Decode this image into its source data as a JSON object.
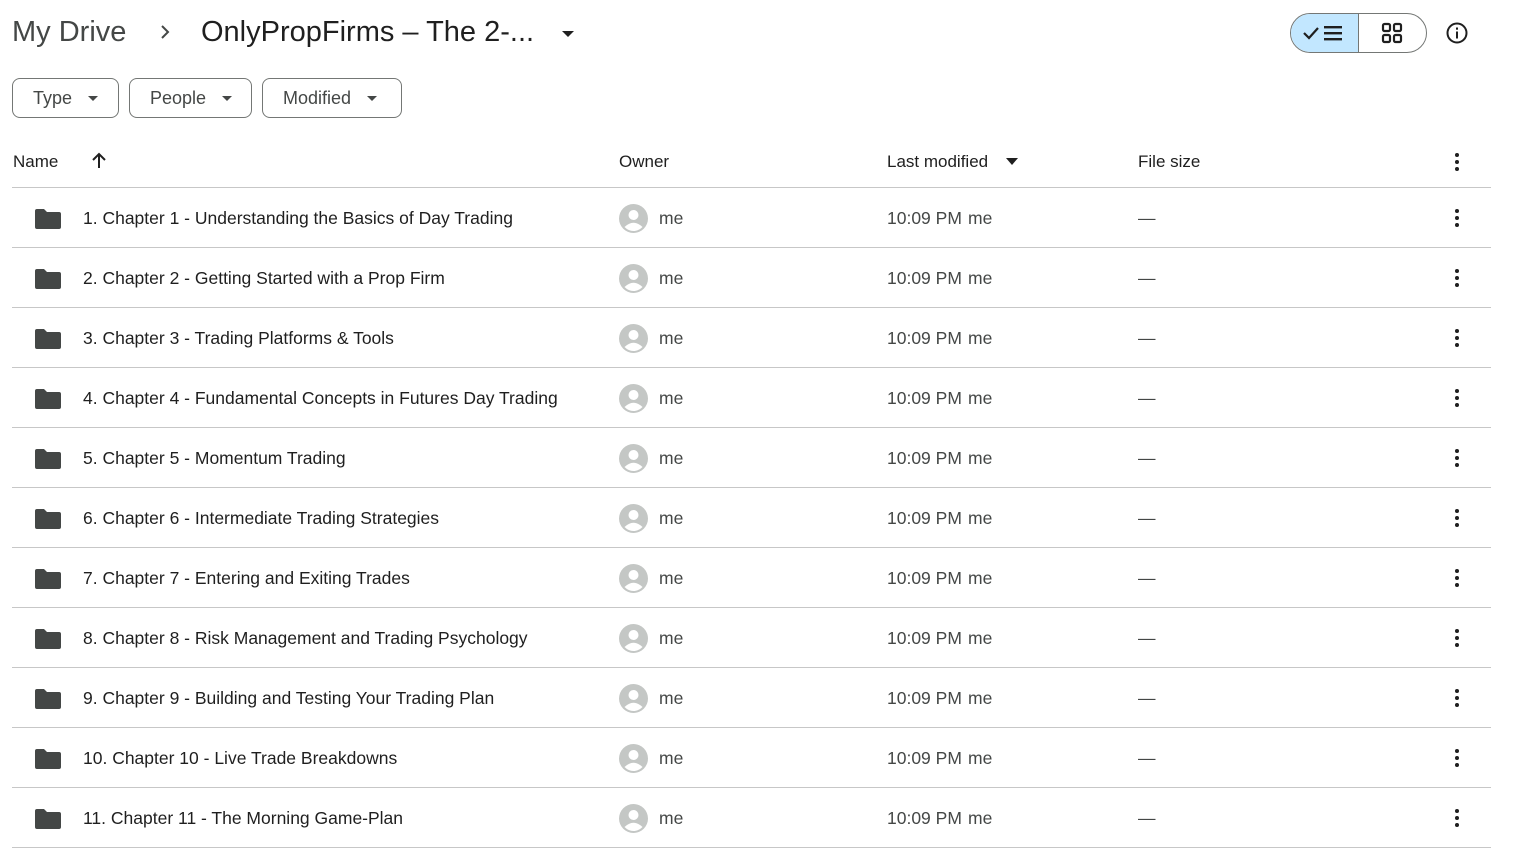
{
  "breadcrumb": {
    "root": "My Drive",
    "separator_icon": "chevron-right-icon",
    "current": "OnlyPropFirms – The 2-...",
    "caret_icon": "caret-down-icon"
  },
  "toolbar": {
    "list_view_icon": "check-list-icon",
    "grid_view_icon": "grid-icon",
    "info_icon": "info-icon",
    "active_view": "list",
    "accent_color": "#c2e7ff"
  },
  "filters": {
    "type": "Type",
    "people": "People",
    "modified": "Modified"
  },
  "columns": {
    "name": "Name",
    "owner": "Owner",
    "last_modified": "Last modified",
    "file_size": "File size",
    "sort_icon": "arrow-up-icon",
    "more_icon": "more-vert-icon"
  },
  "rows": [
    {
      "name": "1. Chapter 1 - Understanding the Basics of Day Trading",
      "owner": "me",
      "time": "10:09 PM",
      "modified_by": "me",
      "size": "—"
    },
    {
      "name": "2. Chapter 2 - Getting Started with a Prop Firm",
      "owner": "me",
      "time": "10:09 PM",
      "modified_by": "me",
      "size": "—"
    },
    {
      "name": "3. Chapter 3 - Trading Platforms & Tools",
      "owner": "me",
      "time": "10:09 PM",
      "modified_by": "me",
      "size": "—"
    },
    {
      "name": "4. Chapter 4 - Fundamental Concepts in Futures Day Trading",
      "owner": "me",
      "time": "10:09 PM",
      "modified_by": "me",
      "size": "—"
    },
    {
      "name": "5. Chapter 5 - Momentum Trading",
      "owner": "me",
      "time": "10:09 PM",
      "modified_by": "me",
      "size": "—"
    },
    {
      "name": "6. Chapter 6 - Intermediate Trading Strategies",
      "owner": "me",
      "time": "10:09 PM",
      "modified_by": "me",
      "size": "—"
    },
    {
      "name": "7. Chapter 7 - Entering and Exiting Trades",
      "owner": "me",
      "time": "10:09 PM",
      "modified_by": "me",
      "size": "—"
    },
    {
      "name": "8. Chapter 8 - Risk Management and Trading Psychology",
      "owner": "me",
      "time": "10:09 PM",
      "modified_by": "me",
      "size": "—"
    },
    {
      "name": "9. Chapter 9 - Building and Testing Your Trading Plan",
      "owner": "me",
      "time": "10:09 PM",
      "modified_by": "me",
      "size": "—"
    },
    {
      "name": "10. Chapter 10 - Live Trade Breakdowns",
      "owner": "me",
      "time": "10:09 PM",
      "modified_by": "me",
      "size": "—"
    },
    {
      "name": "11. Chapter 11 - The Morning Game-Plan",
      "owner": "me",
      "time": "10:09 PM",
      "modified_by": "me",
      "size": "—"
    }
  ]
}
